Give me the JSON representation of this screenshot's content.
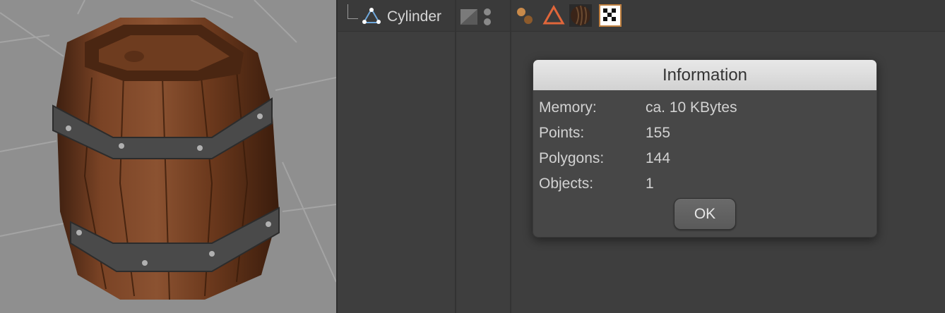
{
  "object_manager": {
    "object_name": "Cylinder",
    "object_icon": "cylinder-primitive-icon",
    "layer_icon": "layer-swatch-icon",
    "tags": [
      "material-balls-icon",
      "phong-triangle-icon",
      "wood-material-sphere-icon",
      "checker-texture-icon"
    ]
  },
  "dialog": {
    "title": "Information",
    "rows": [
      {
        "label": "Memory:",
        "value": "ca. 10 KBytes"
      },
      {
        "label": "Points:",
        "value": "155"
      },
      {
        "label": "Polygons:",
        "value": "144"
      },
      {
        "label": "Objects:",
        "value": "1"
      }
    ],
    "ok_label": "OK"
  },
  "colors": {
    "viewport_bg": "#8f8f8f",
    "panel_bg": "#3e3e3e",
    "dialog_bg": "#474747",
    "title_bar": "#dcdcdc",
    "wood": "#6b3a1f",
    "metal_band": "#4a4a4a"
  }
}
